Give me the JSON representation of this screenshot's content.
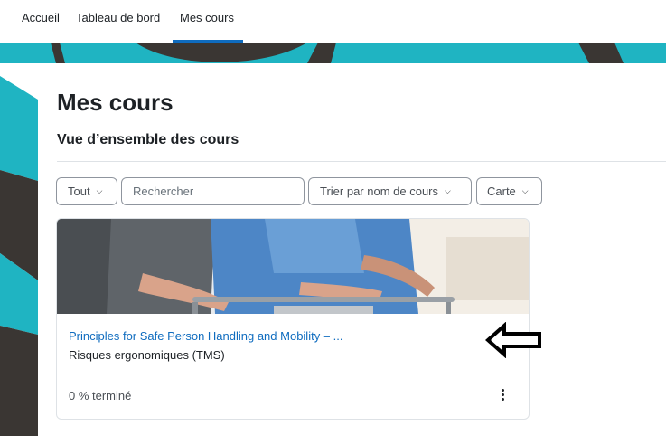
{
  "nav": {
    "items": [
      "Accueil",
      "Tableau de bord",
      "Mes cours"
    ],
    "active": "Mes cours"
  },
  "page": {
    "title": "Mes cours",
    "subtitle": "Vue d’ensemble des cours"
  },
  "filters": {
    "grouping": "Tout",
    "search_placeholder": "Rechercher",
    "sort": "Trier par nom de cours",
    "view": "Carte"
  },
  "course": {
    "name": "Principles for Safe Person Handling and Mobility – ...",
    "category": "Risques ergonomiques (TMS)",
    "progress_text": "0 % terminé"
  },
  "colors": {
    "accent": "#0f6cbf",
    "teal": "#1fb4c2",
    "dark": "#3a3633"
  }
}
